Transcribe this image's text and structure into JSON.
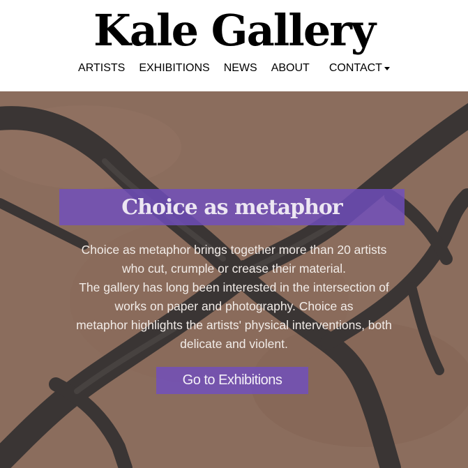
{
  "header": {
    "logo": "Kale Gallery",
    "nav": {
      "artists": "ARTISTS",
      "exhibitions": "EXHIBITIONS",
      "news": "NEWS",
      "about": "ABOUT",
      "contact": "CONTACT"
    }
  },
  "hero": {
    "title": "Choice as metaphor",
    "description_lines": [
      "Choice as metaphor brings together more than 20 artists",
      "who cut, crumple or crease their material.",
      "The gallery has long been interested in the intersection of",
      "works on paper and photography.  Choice as",
      "metaphor highlights the artists' physical interventions, both",
      "delicate and violent."
    ],
    "cta_label": "Go to Exhibitions"
  },
  "colors": {
    "accent_purple": "#704ebe",
    "hero_background": "#9c7a68",
    "brush_stroke": "#3f3b3a",
    "header_background": "#ffffff"
  },
  "icons": {
    "contact_dropdown": "caret-down-icon"
  }
}
